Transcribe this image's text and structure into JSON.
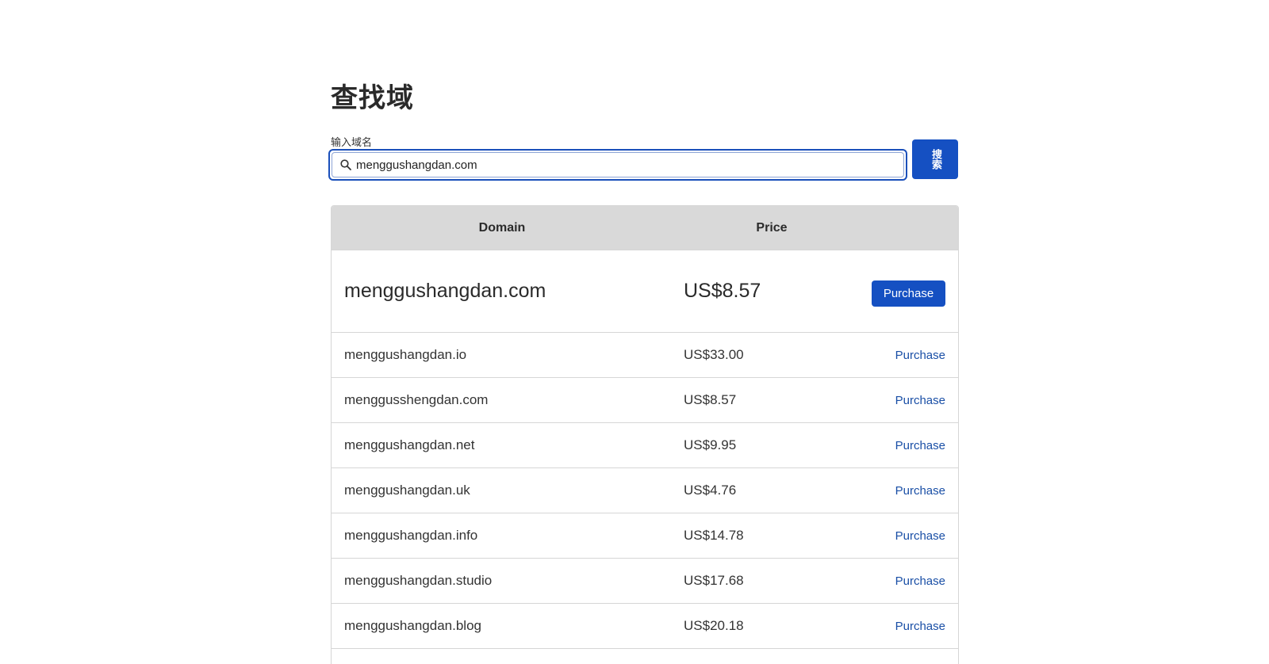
{
  "page": {
    "title": "查找域"
  },
  "search": {
    "label": "输入域名",
    "value": "menggushangdan.com",
    "button_label": "搜索"
  },
  "results": {
    "columns": {
      "domain": "Domain",
      "price": "Price"
    },
    "featured": {
      "domain": "menggushangdan.com",
      "price": "US$8.57",
      "action": "Purchase"
    },
    "rows": [
      {
        "domain": "menggushangdan.io",
        "price": "US$33.00",
        "action": "Purchase"
      },
      {
        "domain": "menggusshengdan.com",
        "price": "US$8.57",
        "action": "Purchase"
      },
      {
        "domain": "menggushangdan.net",
        "price": "US$9.95",
        "action": "Purchase"
      },
      {
        "domain": "menggushangdan.uk",
        "price": "US$4.76",
        "action": "Purchase"
      },
      {
        "domain": "menggushangdan.info",
        "price": "US$14.78",
        "action": "Purchase"
      },
      {
        "domain": "menggushangdan.studio",
        "price": "US$17.68",
        "action": "Purchase"
      },
      {
        "domain": "menggushangdan.blog",
        "price": "US$20.18",
        "action": "Purchase"
      }
    ]
  },
  "colors": {
    "primary": "#1550c2",
    "link": "#1a4fa6",
    "header_bg": "#d9d9d9",
    "border": "#d6d6d6"
  },
  "icons": {
    "search": "search-icon"
  }
}
